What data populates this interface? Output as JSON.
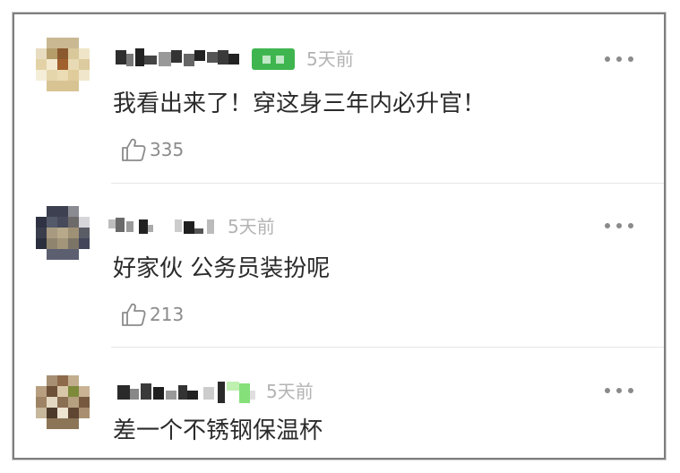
{
  "comments": [
    {
      "time": "5天前",
      "text": "我看出来了！穿这身三年内必升官！",
      "likes": "335",
      "has_badge": true
    },
    {
      "time": "5天前",
      "text": "好家伙 公务员装扮呢",
      "likes": "213",
      "has_badge": false
    },
    {
      "time": "5天前",
      "text": "差一个不锈钢保温杯",
      "likes": "",
      "has_badge": false
    }
  ],
  "icons": {
    "more": "more-dots-icon",
    "like": "thumbs-up-icon"
  },
  "colors": {
    "badge": "#3fb550",
    "time": "#b3b3b3",
    "text": "#2b2b2b",
    "likes": "#8b8b8b"
  }
}
